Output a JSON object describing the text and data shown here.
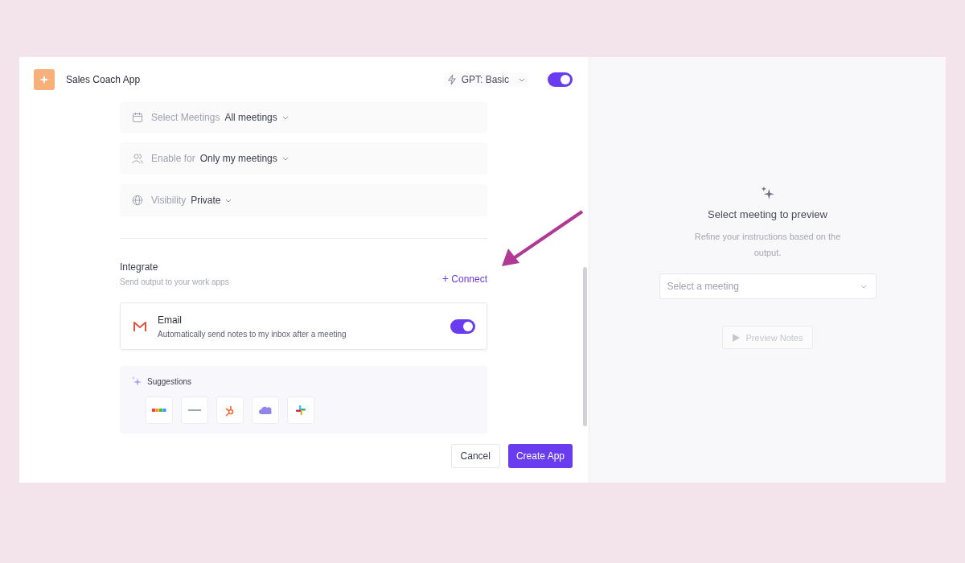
{
  "header": {
    "title": "Sales Coach App",
    "model": "GPT: Basic",
    "enabled": {
      "on": true
    }
  },
  "settings": [
    {
      "kind": "calendar",
      "label": "Select Meetings",
      "value": "All meetings"
    },
    {
      "kind": "people",
      "label": "Enable for",
      "value": "Only my meetings"
    },
    {
      "kind": "globe",
      "label": "Visibility",
      "value": "Private"
    }
  ],
  "integrate": {
    "title": "Integrate",
    "subtitle": "Send output to your work apps",
    "connect": "Connect",
    "plus": "+",
    "integrations": [
      {
        "name": "Email",
        "description": "Automatically send notes to my inbox after a meeting",
        "on": true
      }
    ],
    "suggestions_title": "Suggestions"
  },
  "buttons": {
    "cancel": "Cancel",
    "create": "Create App"
  },
  "preview": {
    "title": "Select meeting to preview",
    "text": "Refine your instructions based on the output.",
    "select_placeholder": "Select a meeting",
    "button": "Preview Notes"
  }
}
